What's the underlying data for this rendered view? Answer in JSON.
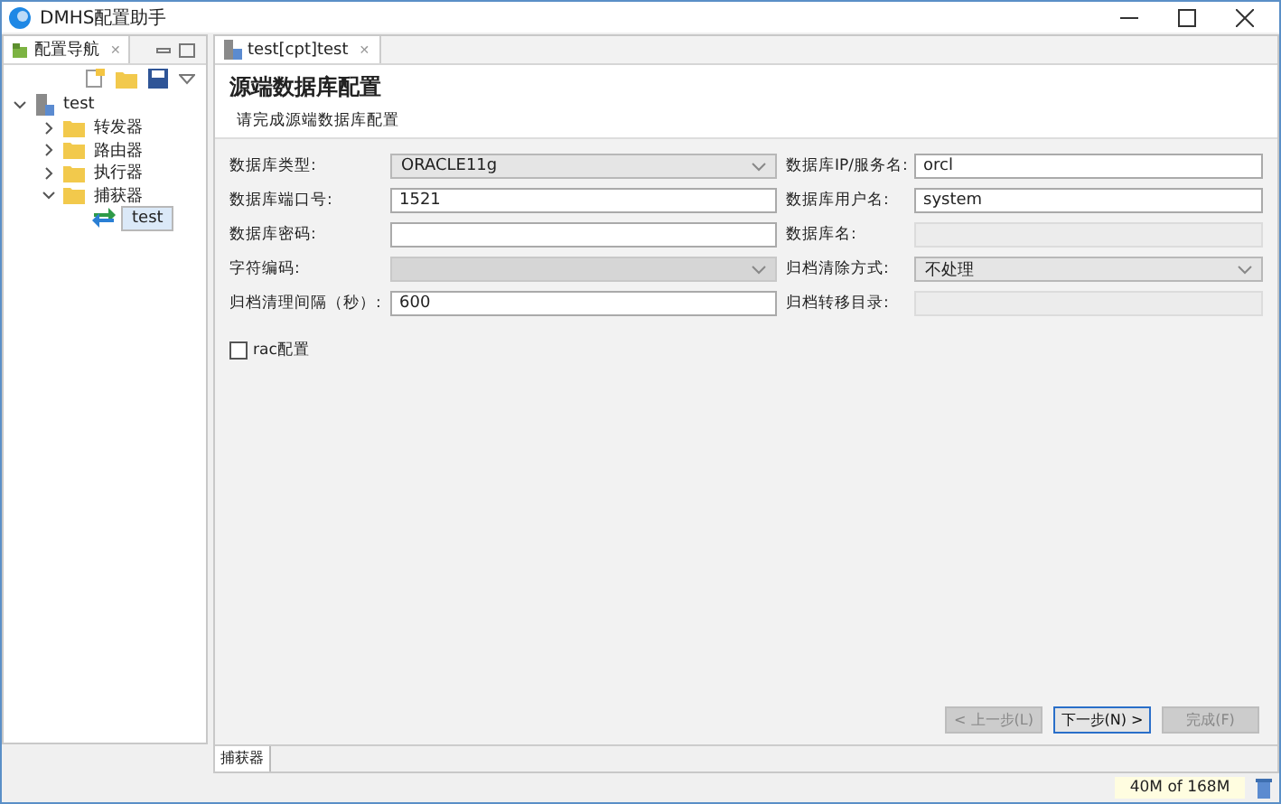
{
  "window": {
    "title": "DMHS配置助手"
  },
  "navigator": {
    "title": "配置导航",
    "close": "✕",
    "tree": [
      {
        "label": "test",
        "kind": "root",
        "expanded": true,
        "children": [
          {
            "label": "转发器",
            "kind": "folder",
            "expanded": false
          },
          {
            "label": "路由器",
            "kind": "folder",
            "expanded": false
          },
          {
            "label": "执行器",
            "kind": "folder",
            "expanded": false
          },
          {
            "label": "捕获器",
            "kind": "folder",
            "expanded": true,
            "children": [
              {
                "label": "test",
                "kind": "node",
                "selected": true
              }
            ]
          }
        ]
      }
    ]
  },
  "editor_tab": {
    "label": "test[cpt]test",
    "close": "✕"
  },
  "header": {
    "title": "源端数据库配置",
    "subtitle": "请完成源端数据库配置"
  },
  "fields": [
    {
      "label": "数据库类型:",
      "kind": "select",
      "value": "ORACLE11g",
      "disabled": false
    },
    {
      "label": "数据库IP/服务名:",
      "kind": "input",
      "value": "orcl",
      "disabled": false
    },
    {
      "label": "数据库端口号:",
      "kind": "input",
      "value": "1521",
      "disabled": false
    },
    {
      "label": "数据库用户名:",
      "kind": "input",
      "value": "system",
      "disabled": false
    },
    {
      "label": "数据库密码:",
      "kind": "input",
      "disabled": false
    },
    {
      "label": "数据库名:",
      "kind": "input",
      "disabled": true
    },
    {
      "label": "字符编码:",
      "kind": "select",
      "disabled": true
    },
    {
      "label": "归档清除方式:",
      "kind": "select",
      "value": "不处理",
      "disabled": false
    },
    {
      "label": "归档清理间隔（秒）:",
      "kind": "input",
      "value": "600",
      "disabled": false
    },
    {
      "label": "归档转移目录:",
      "kind": "input",
      "disabled": true
    }
  ],
  "rac": {
    "label": "rac配置",
    "checked": false
  },
  "buttons": [
    {
      "label": "< 上一步(L)",
      "disabled": true
    },
    {
      "label": "下一步(N) >",
      "disabled": false
    },
    {
      "label": "完成(F)",
      "disabled": true
    }
  ],
  "bottom_tab": {
    "label": "捕获器"
  },
  "status_bar": {
    "memory": "40M of 168M"
  }
}
